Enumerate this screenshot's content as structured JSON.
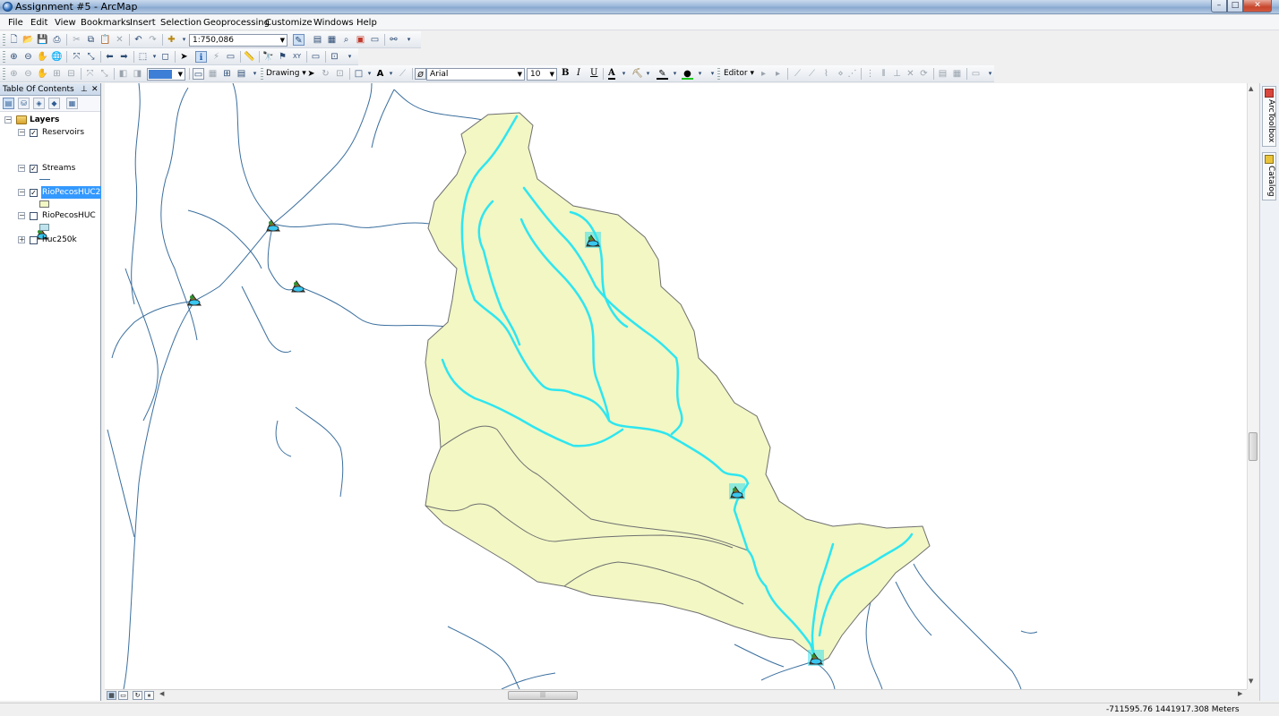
{
  "window": {
    "title": "Assignment #5 - ArcMap"
  },
  "menu": [
    "File",
    "Edit",
    "View",
    "Bookmarks",
    "Insert",
    "Selection",
    "Geoprocessing",
    "Customize",
    "Windows",
    "Help"
  ],
  "toolbar": {
    "scale_value": "1:750,086",
    "drawing_label": "Drawing",
    "font_name": "Arial",
    "font_size": "10",
    "bold": "B",
    "italic": "I",
    "underline": "U",
    "font_color_letter": "A",
    "editor_label": "Editor"
  },
  "toc": {
    "title": "Table Of Contents",
    "root_label": "Layers",
    "layers": [
      {
        "name": "Reservoirs",
        "checked": true,
        "expanded": true,
        "selected": false
      },
      {
        "name": "Streams",
        "checked": true,
        "expanded": true,
        "selected": false
      },
      {
        "name": "RioPecosHUC2",
        "checked": true,
        "expanded": true,
        "selected": true
      },
      {
        "name": "RioPecosHUC",
        "checked": false,
        "expanded": true,
        "selected": false
      },
      {
        "name": "huc250k",
        "checked": false,
        "expanded": false,
        "selected": false
      }
    ]
  },
  "dock": {
    "arctoolbox": "ArcToolbox",
    "catalog": "Catalog"
  },
  "status": {
    "coordinates": "-711595.76  1441917.308 Meters"
  },
  "colors": {
    "watershed_fill": "#f2f7c4",
    "watershed_outline": "#6f6f6f",
    "selected_streams": "#2ee6f0",
    "streams": "#3b6f9e",
    "selection_highlight": "#3399ff"
  },
  "icons": {
    "reservoir": "reservoir-symbol-icon",
    "app": "arcmap-globe-icon"
  }
}
